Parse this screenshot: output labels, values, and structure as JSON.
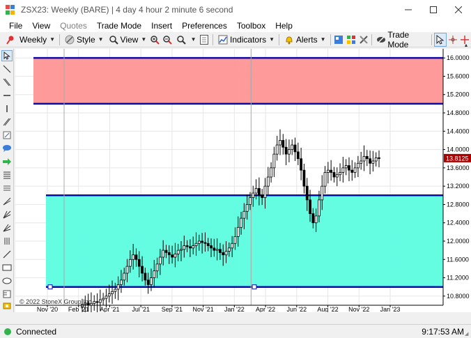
{
  "window": {
    "title": "ZSX23: Weekly (BARE) | 4 day 4 hour 2 minute 6 second",
    "controls": [
      "minimize",
      "maximize",
      "close"
    ]
  },
  "menu": [
    {
      "label": "File",
      "enabled": true
    },
    {
      "label": "View",
      "enabled": true
    },
    {
      "label": "Quotes",
      "enabled": false
    },
    {
      "label": "Trade Mode",
      "enabled": true
    },
    {
      "label": "Insert",
      "enabled": true
    },
    {
      "label": "Preferences",
      "enabled": true
    },
    {
      "label": "Toolbox",
      "enabled": true
    },
    {
      "label": "Help",
      "enabled": true
    }
  ],
  "toolbar": {
    "period_label": "Weekly",
    "style_label": "Style",
    "view_label": "View",
    "indicators_label": "Indicators",
    "alerts_label": "Alerts",
    "trade_mode_label": "Trade Mode"
  },
  "chart_data": {
    "type": "candlestick",
    "symbol": "ZSX23",
    "x_tick_labels": [
      "Nov '20",
      "Feb '21",
      "Apr '21",
      "Jul '21",
      "Sep '21",
      "Nov '21",
      "Jan '22",
      "Apr '22",
      "Jun '22",
      "Aug '22",
      "Nov '22",
      "Jan '23"
    ],
    "y_tick_labels": [
      "16.0000",
      "15.6000",
      "15.2000",
      "14.8000",
      "14.4000",
      "14.0000",
      "13.6000",
      "13.2000",
      "12.8000",
      "12.4000",
      "12.0000",
      "11.6000",
      "11.2000",
      "10.8000"
    ],
    "ylim": [
      10.6,
      16.2
    ],
    "grid": true,
    "last_price": 13.8125,
    "last_price_label": "13.8125",
    "zones": [
      {
        "name": "upper-zone",
        "top": 16.0,
        "bottom": 15.0,
        "color": "#ff9595"
      },
      {
        "name": "lower-zone",
        "top": 13.0,
        "bottom": 11.0,
        "color": "#5dfde0"
      }
    ],
    "vertical_markers": [
      "Nov '20",
      "Jan '22"
    ],
    "closes": [
      10.62,
      10.65,
      10.6,
      10.64,
      10.68,
      10.66,
      10.72,
      10.75,
      10.8,
      10.85,
      10.9,
      10.95,
      11.05,
      11.15,
      11.3,
      11.45,
      11.6,
      11.7,
      11.6,
      11.45,
      11.3,
      11.15,
      11.05,
      11.2,
      11.35,
      11.5,
      11.65,
      11.8,
      11.75,
      11.7,
      11.65,
      11.72,
      11.8,
      11.82,
      11.9,
      11.88,
      11.85,
      11.9,
      11.95,
      12.0,
      11.97,
      11.95,
      11.9,
      11.85,
      11.8,
      11.82,
      11.75,
      11.7,
      11.78,
      11.85,
      11.95,
      12.1,
      12.3,
      12.5,
      12.65,
      12.8,
      12.95,
      13.05,
      13.15,
      13.0,
      12.95,
      13.2,
      13.4,
      13.6,
      13.9,
      14.1,
      14.2,
      14.05,
      13.9,
      14.0,
      14.1,
      13.95,
      13.8,
      13.55,
      13.2,
      12.9,
      12.6,
      12.4,
      12.55,
      12.9,
      13.2,
      13.5,
      13.55,
      13.5,
      13.4,
      13.45,
      13.5,
      13.6,
      13.65,
      13.55,
      13.5,
      13.6,
      13.7,
      13.75,
      13.85,
      13.8,
      13.7,
      13.75,
      13.82,
      13.8125
    ]
  },
  "watermark": "© 2022 StoneX Group Inc.",
  "status": {
    "text": "Connected",
    "time": "9:17:53 AM",
    "color": "#2fb54a"
  }
}
